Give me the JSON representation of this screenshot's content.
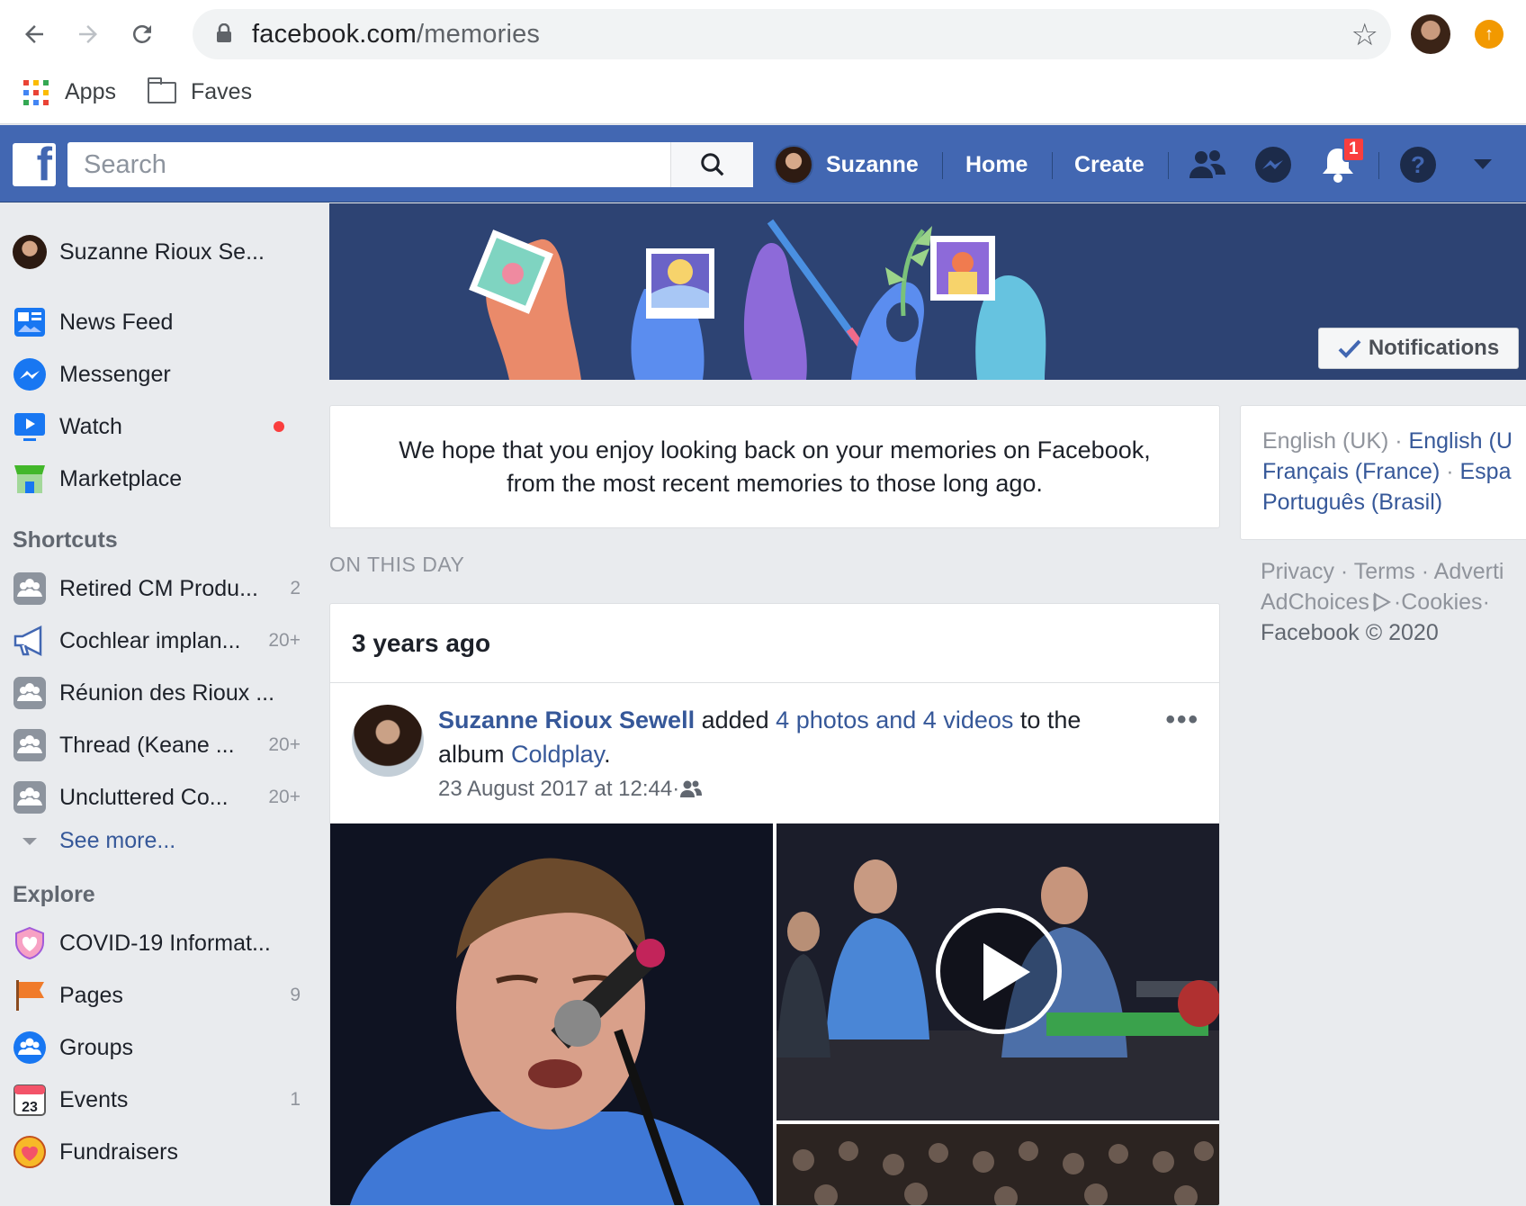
{
  "browser": {
    "url_host": "facebook.com",
    "url_path": "/memories",
    "bookmarks": [
      {
        "label": "Apps",
        "icon": "apps-grid-icon"
      },
      {
        "label": "Faves",
        "icon": "folder-icon"
      }
    ]
  },
  "topbar": {
    "search_placeholder": "Search",
    "profile_name": "Suzanne",
    "home_label": "Home",
    "create_label": "Create",
    "notifications_badge": "1"
  },
  "sidebar": {
    "profile_name": "Suzanne Rioux Se...",
    "main_items": [
      {
        "label": "News Feed",
        "icon": "news-feed-icon"
      },
      {
        "label": "Messenger",
        "icon": "messenger-icon"
      },
      {
        "label": "Watch",
        "icon": "watch-icon"
      },
      {
        "label": "Marketplace",
        "icon": "marketplace-icon"
      }
    ],
    "shortcuts_heading": "Shortcuts",
    "shortcuts": [
      {
        "label": "Retired CM Produ...",
        "count": "2"
      },
      {
        "label": "Cochlear implan...",
        "count": "20+"
      },
      {
        "label": "Réunion des Rioux ...",
        "count": ""
      },
      {
        "label": "Thread (Keane ...",
        "count": "20+"
      },
      {
        "label": "Uncluttered Co...",
        "count": "20+"
      }
    ],
    "see_more_label": "See more...",
    "explore_heading": "Explore",
    "explore": [
      {
        "label": "COVID-19 Informat...",
        "count": "",
        "icon": "covid-heart-icon"
      },
      {
        "label": "Pages",
        "count": "9",
        "icon": "pages-flag-icon"
      },
      {
        "label": "Groups",
        "count": "",
        "icon": "groups-icon"
      },
      {
        "label": "Events",
        "count": "1",
        "icon": "events-calendar-icon",
        "icon_text": "23"
      },
      {
        "label": "Fundraisers",
        "count": "",
        "icon": "fundraisers-icon"
      }
    ]
  },
  "cover": {
    "notifications_button": "Notifications"
  },
  "intro": {
    "line1": "We hope that you enjoy looking back on your memories on Facebook,",
    "line2": "from the most recent memories to those long ago."
  },
  "memories": {
    "section_label": "ON THIS DAY",
    "card_title": "3 years ago",
    "post": {
      "author": "Suzanne Rioux Sewell",
      "verb": " added ",
      "media_link": "4 photos and 4 videos",
      "mid_text": " to the album ",
      "album": "Coldplay",
      "end": ".",
      "timestamp": "23 August 2017 at 12:44",
      "separator": " · "
    }
  },
  "right": {
    "lang_current": "English (UK)",
    "lang_links": [
      "English (U",
      "Français (France)",
      "Espa",
      "Português (Brasil)"
    ],
    "dot": " · ",
    "footer_line1": [
      "Privacy",
      "Terms",
      "Adverti"
    ],
    "footer_line2": [
      "AdChoices",
      "Cookies"
    ],
    "copyright": "Facebook © 2020"
  },
  "colors": {
    "brand_blue": "#4267b2",
    "link_blue": "#365899",
    "badge_red": "#fa3e3e"
  }
}
